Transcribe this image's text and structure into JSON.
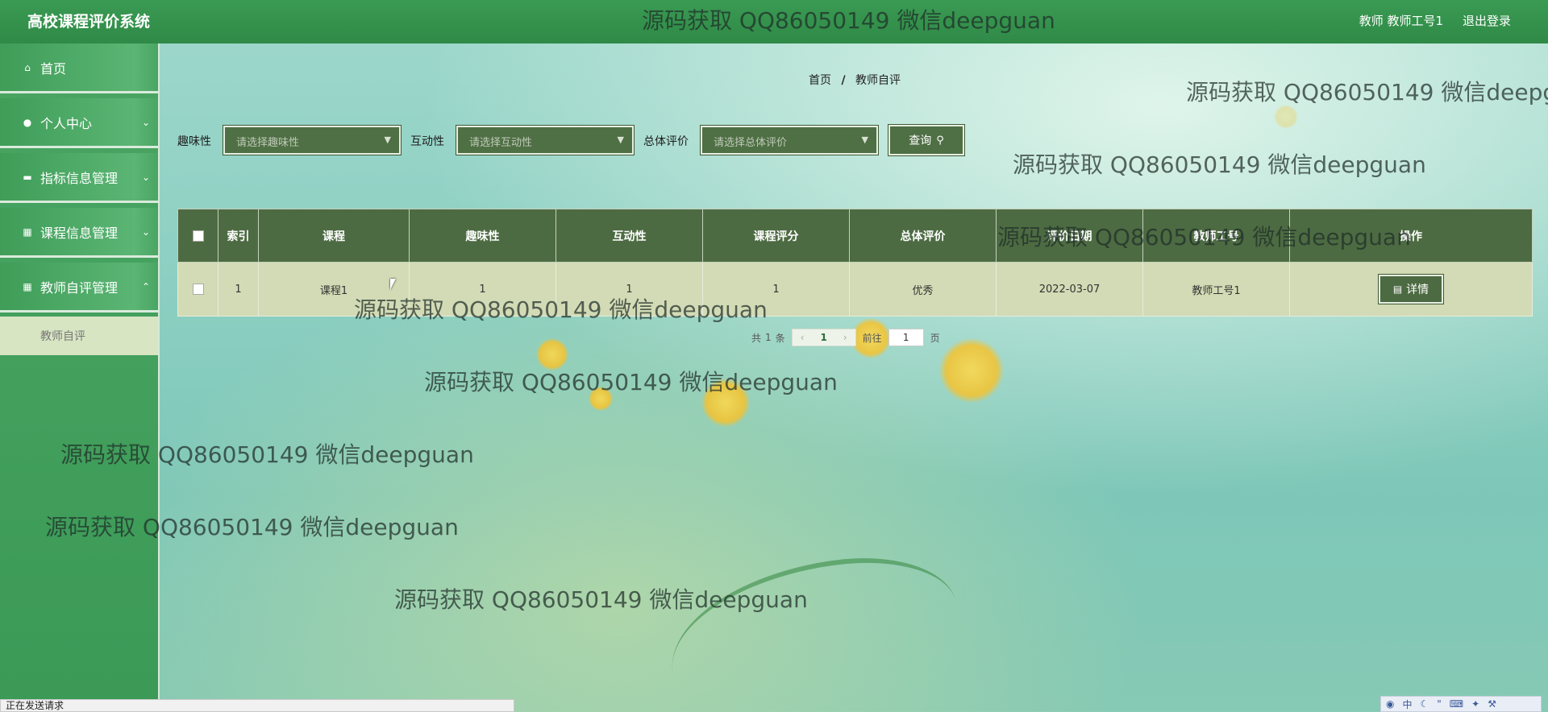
{
  "header": {
    "app_title": "高校课程评价系统",
    "user": "教师  教师工号1",
    "logout": "退出登录"
  },
  "sidebar": {
    "items": [
      {
        "label": "首页",
        "icon": "home-icon"
      },
      {
        "label": "个人中心",
        "icon": "user-icon"
      },
      {
        "label": "指标信息管理",
        "icon": "monitor-icon"
      },
      {
        "label": "课程信息管理",
        "icon": "grid-icon"
      },
      {
        "label": "教师自评管理",
        "icon": "grid-icon"
      }
    ],
    "sub_item": "教师自评"
  },
  "breadcrumb": {
    "home": "首页",
    "sep": "/",
    "current": "教师自评"
  },
  "filters": {
    "interest_label": "趣味性",
    "interest_placeholder": "请选择趣味性",
    "interaction_label": "互动性",
    "interaction_placeholder": "请选择互动性",
    "overall_label": "总体评价",
    "overall_placeholder": "请选择总体评价",
    "query_button": "查询"
  },
  "table": {
    "headers": [
      "索引",
      "课程",
      "趣味性",
      "互动性",
      "课程评分",
      "总体评价",
      "评价日期",
      "教师工号",
      "操作"
    ],
    "rows": [
      {
        "index": "1",
        "course": "课程1",
        "interest": "1",
        "interaction": "1",
        "score": "1",
        "overall": "优秀",
        "date": "2022-03-07",
        "teacher_id": "教师工号1",
        "action": "详情"
      }
    ]
  },
  "pagination": {
    "total_prefix": "共",
    "total": "1",
    "total_suffix": "条",
    "current_page": "1",
    "goto_prefix": "前往",
    "goto_value": "1",
    "goto_suffix": "页"
  },
  "watermark": "源码获取 QQ86050149 微信deepguan",
  "status_bar": "正在发送请求",
  "tray": {
    "ime": "中"
  },
  "colors": {
    "header_green": "#2f8a47",
    "table_header": "#4d6b42",
    "row_bg": "#d2dbb5",
    "button": "#4f6f45"
  }
}
